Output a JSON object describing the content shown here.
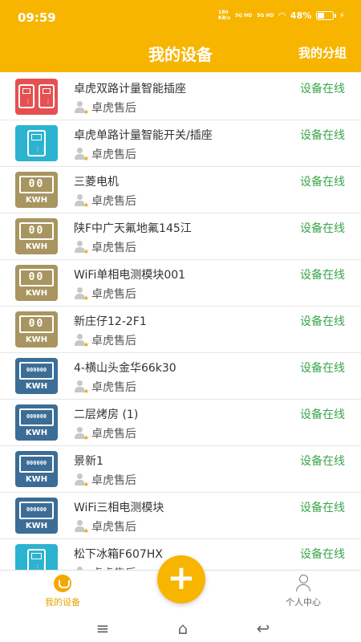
{
  "status_bar": {
    "time": "09:59",
    "net_speed": "180",
    "net_unit": "KB/s",
    "signal1": "5G HD",
    "signal2": "5G HD",
    "battery": "48%",
    "battery_level": 0.48
  },
  "header": {
    "title": "我的设备",
    "group_label": "我的分组"
  },
  "devices": [
    {
      "name": "卓虎双路计量智能插座",
      "owner": "卓虎售后",
      "status": "设备在线",
      "icon": "dual-socket-icon"
    },
    {
      "name": "卓虎单路计量智能开关/插座",
      "owner": "卓虎售后",
      "status": "设备在线",
      "icon": "single-socket-icon"
    },
    {
      "name": "三菱电机",
      "owner": "卓虎售后",
      "status": "设备在线",
      "icon": "kwh-meter-icon"
    },
    {
      "name": "陕F中广天氟地氟145江",
      "owner": "卓虎售后",
      "status": "设备在线",
      "icon": "kwh-meter-icon"
    },
    {
      "name": "WiFi单相电测模块001",
      "owner": "卓虎售后",
      "status": "设备在线",
      "icon": "kwh-meter-icon"
    },
    {
      "name": "新庄仔12-2F1",
      "owner": "卓虎售后",
      "status": "设备在线",
      "icon": "kwh-meter-icon"
    },
    {
      "name": "4-横山头金华66k30",
      "owner": "卓虎售后",
      "status": "设备在线",
      "icon": "three-phase-meter-icon"
    },
    {
      "name": "二层烤房 (1)",
      "owner": "卓虎售后",
      "status": "设备在线",
      "icon": "three-phase-meter-icon"
    },
    {
      "name": "景新1",
      "owner": "卓虎售后",
      "status": "设备在线",
      "icon": "three-phase-meter-icon"
    },
    {
      "name": "WiFi三相电测模块",
      "owner": "卓虎售后",
      "status": "设备在线",
      "icon": "three-phase-meter-icon"
    },
    {
      "name": "松下冰箱F607HX",
      "owner": "卓虎售后",
      "status": "设备在线",
      "icon": "single-socket-icon"
    }
  ],
  "meter_text": {
    "single_display": "00",
    "three_display": "000000",
    "unit": "KWH"
  },
  "tabbar": {
    "home_label": "我的设备",
    "add_label": "+",
    "me_label": "个人中心"
  },
  "colors": {
    "accent": "#f7b500",
    "online": "#3aa54a"
  }
}
